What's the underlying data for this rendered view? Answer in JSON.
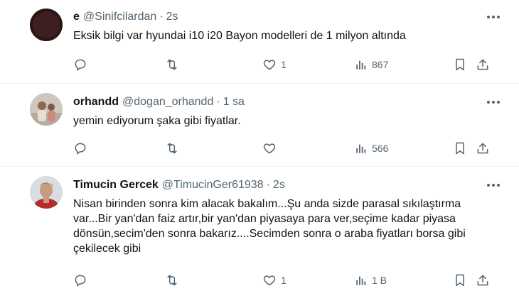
{
  "tweets": [
    {
      "name": "e",
      "handle": "@Sinifcilardan",
      "sep": "·",
      "time": "2s",
      "text": "Eksik bilgi var hyundai i10 i20 Bayon modelleri de 1 milyon altında",
      "likes": "1",
      "views": "867",
      "avatar": "dark"
    },
    {
      "name": "orhandd",
      "handle": "@dogan_orhandd",
      "sep": "·",
      "time": "1 sa",
      "text": "yemin ediyorum şaka gibi fiyatlar.",
      "likes": "",
      "views": "566",
      "avatar": "photo-people"
    },
    {
      "name": "Timucin Gercek",
      "handle": "@TimucinGer61938",
      "sep": "·",
      "time": "2s",
      "text": "Nisan birinden sonra kim alacak bakalım...Şu anda sizde parasal sıkılaştırma var...Bir yan'dan faiz artır,bir yan'dan piyasaya para ver,seçime kadar piyasa dönsün,secim'den sonra bakarız....Secimden sonra o araba fiyatları borsa gibi çekilecek gibi",
      "likes": "1",
      "views": "1 B",
      "avatar": "photo-man"
    }
  ],
  "colors": {
    "text": "#0f1419",
    "secondary": "#536471",
    "border": "#eff3f4"
  }
}
